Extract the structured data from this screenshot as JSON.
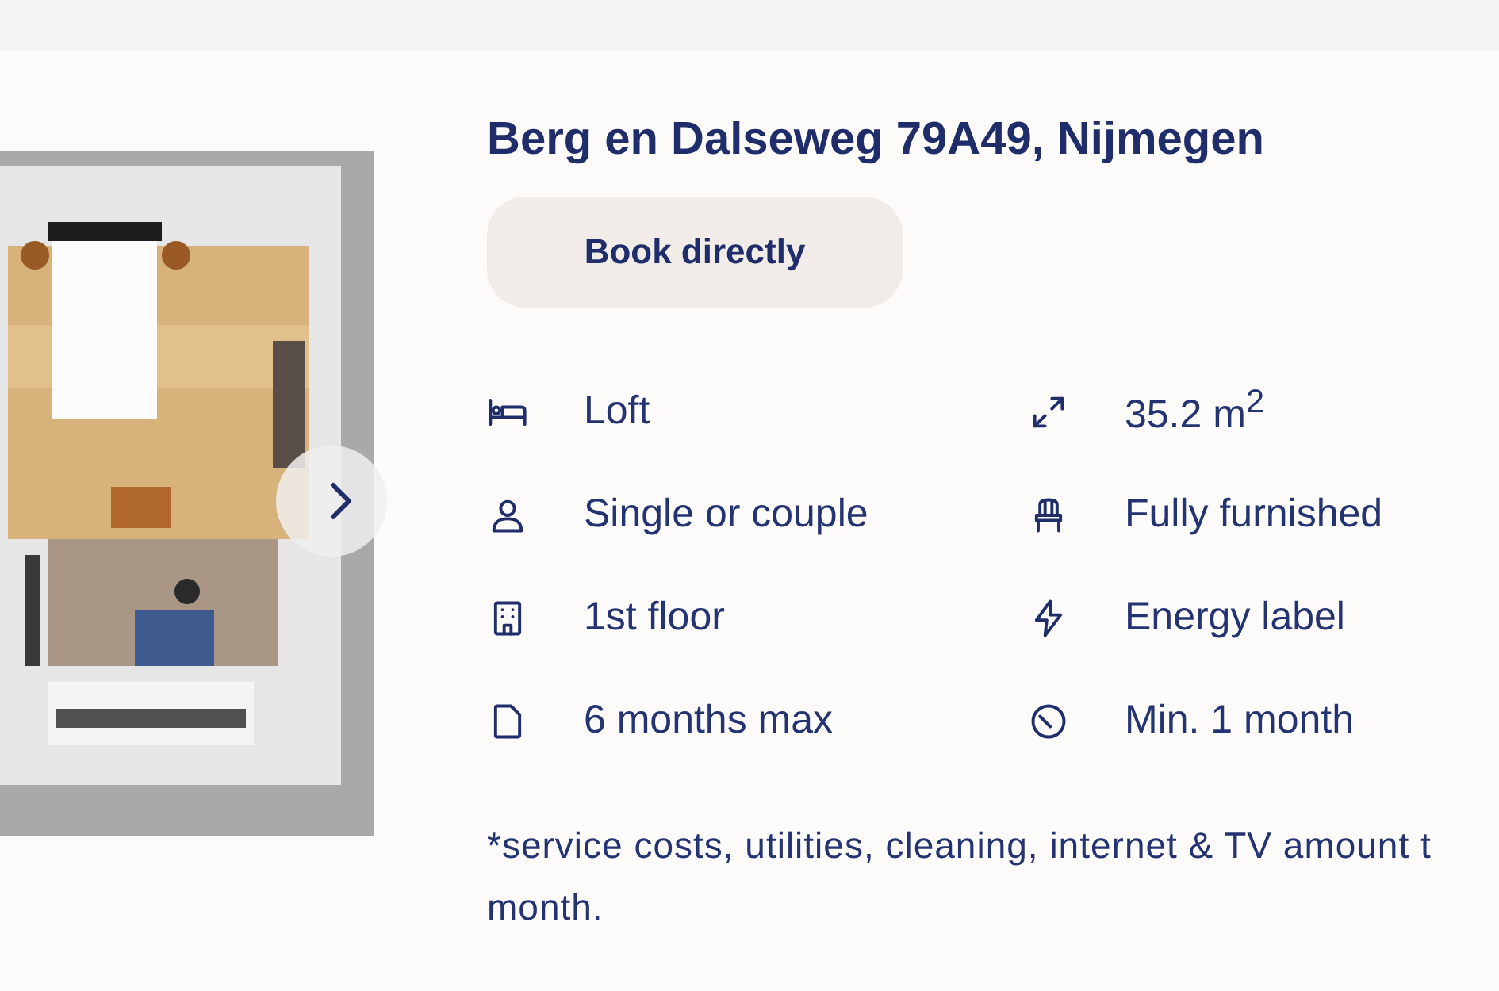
{
  "listing": {
    "title": "Berg en Dalseweg 79A49, Nijmegen",
    "book_button": "Book directly",
    "features": [
      {
        "label": "Loft"
      },
      {
        "label": "35.2 m$^{2}$"
      },
      {
        "label": "Single or couple"
      },
      {
        "label": "Fully furnished"
      },
      {
        "label": "1st floor"
      },
      {
        "label": "Energy label"
      },
      {
        "label": "6 months max"
      },
      {
        "label": "Min. 1 month"
      }
    ],
    "footnote_lines": [
      "*service costs, utilities, cleaning, internet & TV amount t",
      "month."
    ]
  }
}
